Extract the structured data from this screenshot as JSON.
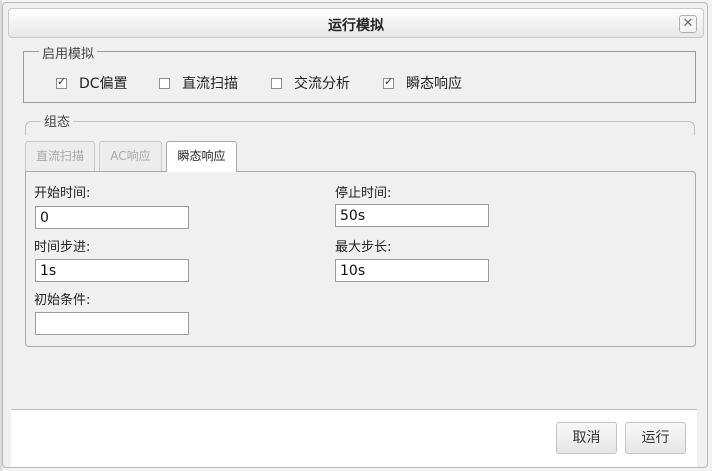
{
  "dialog": {
    "title": "运行模拟"
  },
  "enable_group": {
    "legend": "启用模拟",
    "options": [
      {
        "label": "DC偏置",
        "checked": true
      },
      {
        "label": "直流扫描",
        "checked": false
      },
      {
        "label": "交流分析",
        "checked": false
      },
      {
        "label": "瞬态响应",
        "checked": true
      }
    ]
  },
  "config_group": {
    "legend": "组态",
    "tabs": [
      {
        "label": "直流扫描",
        "active": false
      },
      {
        "label": "AC响应",
        "active": false
      },
      {
        "label": "瞬态响应",
        "active": true
      }
    ],
    "fields": {
      "start_time": {
        "label": "开始时间:",
        "value": "0"
      },
      "stop_time": {
        "label": "停止时间:",
        "value": "50s"
      },
      "time_step": {
        "label": "时间步进:",
        "value": "1s"
      },
      "max_step": {
        "label": "最大步长:",
        "value": "10s"
      },
      "initial_condition": {
        "label": "初始条件:",
        "value": ""
      }
    }
  },
  "buttons": {
    "cancel": "取消",
    "run": "运行"
  }
}
